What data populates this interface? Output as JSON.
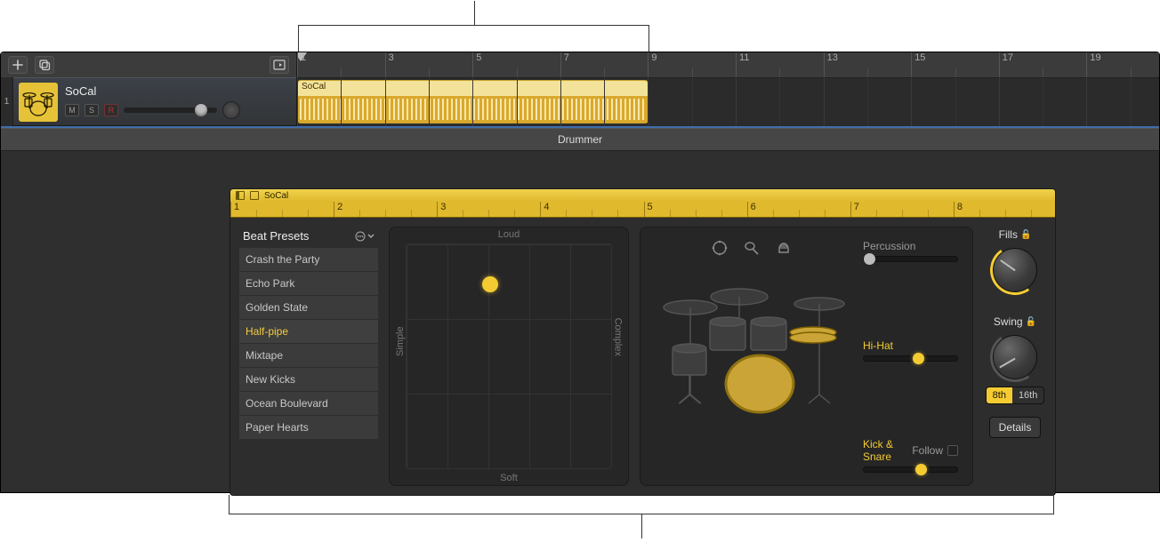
{
  "track": {
    "number": "1",
    "name": "SoCal",
    "mute": "M",
    "solo": "S",
    "record": "R"
  },
  "ruler": {
    "labels": [
      "1",
      "3",
      "5",
      "7",
      "9",
      "11",
      "13",
      "15",
      "17",
      "19"
    ]
  },
  "region": {
    "name": "SoCal"
  },
  "drummer_tab": "Drummer",
  "editor": {
    "region_name": "SoCal",
    "ruler_labels": [
      "1",
      "2",
      "3",
      "4",
      "5",
      "6",
      "7",
      "8"
    ]
  },
  "presets": {
    "title": "Beat Presets",
    "items": [
      "Crash the Party",
      "Echo Park",
      "Golden State",
      "Half-pipe",
      "Mixtape",
      "New Kicks",
      "Ocean Boulevard",
      "Paper Hearts"
    ],
    "selected_index": 3
  },
  "xy": {
    "top": "Loud",
    "bottom": "Soft",
    "left": "Simple",
    "right": "Complex"
  },
  "sliders": {
    "percussion": {
      "label": "Percussion"
    },
    "hihat": {
      "label": "Hi-Hat"
    },
    "kicksnare": {
      "label": "Kick & Snare",
      "follow_label": "Follow"
    }
  },
  "knobs": {
    "fills": "Fills",
    "swing": "Swing",
    "seg_a": "8th",
    "seg_b": "16th"
  },
  "details_btn": "Details"
}
